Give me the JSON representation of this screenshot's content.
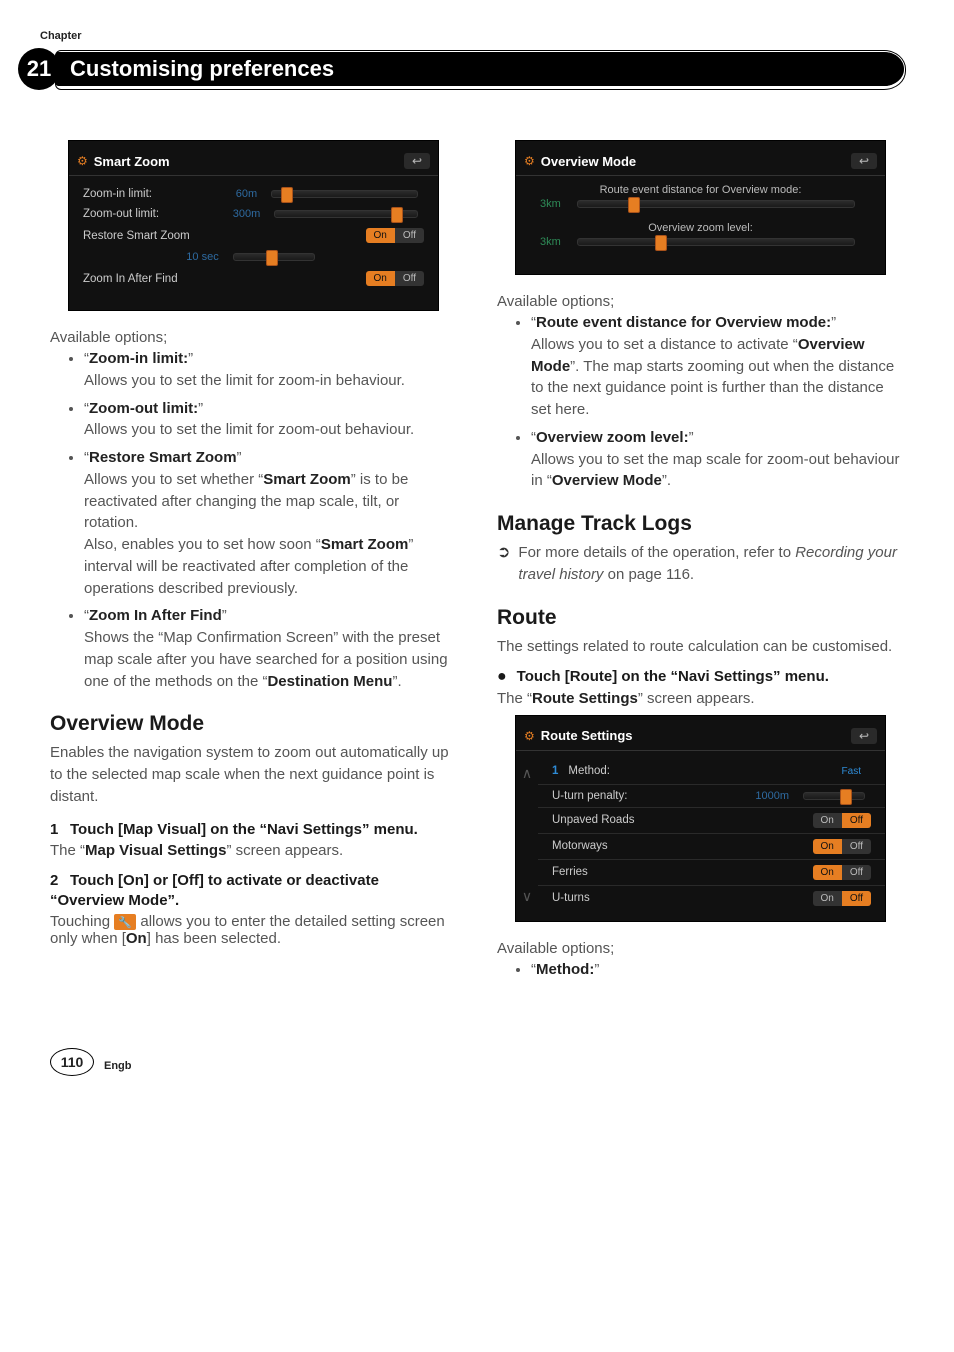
{
  "header": {
    "chapter_label": "Chapter",
    "chapter_number": "21",
    "title": "Customising preferences"
  },
  "shot_smart_zoom": {
    "title": "Smart Zoom",
    "rows": {
      "zoom_in_label": "Zoom-in limit:",
      "zoom_in_value": "60m",
      "zoom_out_label": "Zoom-out limit:",
      "zoom_out_value": "300m",
      "restore_label": "Restore Smart Zoom",
      "restore_on": "On",
      "restore_off": "Off",
      "interval_value": "10 sec",
      "after_find_label": "Zoom In After Find",
      "after_find_on": "On",
      "after_find_off": "Off"
    }
  },
  "left": {
    "available": "Available options;",
    "b1_term": "Zoom-in limit:",
    "b1_body": "Allows you to set the limit for zoom-in behaviour.",
    "b2_term": "Zoom-out limit:",
    "b2_body": "Allows you to set the limit for zoom-out behaviour.",
    "b3_term": "Restore Smart Zoom",
    "b3_body_a": "Allows you to set whether “",
    "b3_body_a_bold": "Smart Zoom",
    "b3_body_a_end": "” is to be reactivated after changing the map scale, tilt, or rotation.",
    "b3_body_b": "Also, enables you to set how soon “",
    "b3_body_b_bold": "Smart Zoom",
    "b3_body_b_end": "” interval will be reactivated after completion of the operations described previously.",
    "b4_term": "Zoom In After Find",
    "b4_body_a": "Shows the “Map Confirmation Screen” with the preset map scale after you have searched for a position using one of the methods on the “",
    "b4_body_a_bold": "Destination Menu",
    "b4_body_a_end": "”.",
    "overview_heading": "Overview Mode",
    "overview_intro": "Enables the navigation system to zoom out automatically up to the selected map scale when the next guidance point is distant.",
    "step1": "Touch [Map Visual] on the “Navi Settings” menu.",
    "step1_result_a": "The “",
    "step1_result_bold": "Map Visual Settings",
    "step1_result_b": "” screen appears.",
    "step2": "Touch [On] or [Off] to activate or deactivate “Overview Mode”.",
    "step2_body_a": "Touching ",
    "step2_body_b": " allows you to enter the detailed setting screen only when [",
    "step2_on": "On",
    "step2_body_c": "] has been selected."
  },
  "shot_overview": {
    "title": "Overview Mode",
    "row1_label": "Route event distance for Overview mode:",
    "row1_value": "3km",
    "row2_label": "Overview zoom level:",
    "row2_value": "3km"
  },
  "right": {
    "available": "Available options;",
    "b1_term": "Route event distance for Overview mode:",
    "b1_body_a": "Allows you to set a distance to activate “",
    "b1_body_bold": "Overview Mode",
    "b1_body_b": "”. The map starts zooming out when the distance to the next guidance point is further than the distance set here.",
    "b2_term": "Overview zoom level:",
    "b2_body_a": "Allows you to set the map scale for zoom-out behaviour in “",
    "b2_body_bold": "Overview Mode",
    "b2_body_b": "”.",
    "track_heading": "Manage Track Logs",
    "track_xref_a": "For more details of the operation, refer to ",
    "track_xref_i": "Recording your travel history",
    "track_xref_b": " on page 116.",
    "route_heading": "Route",
    "route_intro": "The settings related to route calculation can be customised.",
    "route_step": "Touch [Route] on the “Navi Settings” menu.",
    "route_result_a": "The “",
    "route_result_bold": "Route Settings",
    "route_result_b": "” screen appears.",
    "available2": "Available options;",
    "method_term": "Method:"
  },
  "shot_route": {
    "title": "Route Settings",
    "rows": [
      {
        "label": "Method:",
        "right": "Fast"
      },
      {
        "label": "U-turn penalty:",
        "right": "1000m"
      },
      {
        "label": "Unpaved Roads",
        "on": "On",
        "off": "Off",
        "active": "off"
      },
      {
        "label": "Motorways",
        "on": "On",
        "off": "Off",
        "active": "on"
      },
      {
        "label": "Ferries",
        "on": "On",
        "off": "Off",
        "active": "on"
      },
      {
        "label": "U-turns",
        "on": "On",
        "off": "Off",
        "active": "off"
      }
    ]
  },
  "footer": {
    "page": "110",
    "lang": "Engb"
  }
}
